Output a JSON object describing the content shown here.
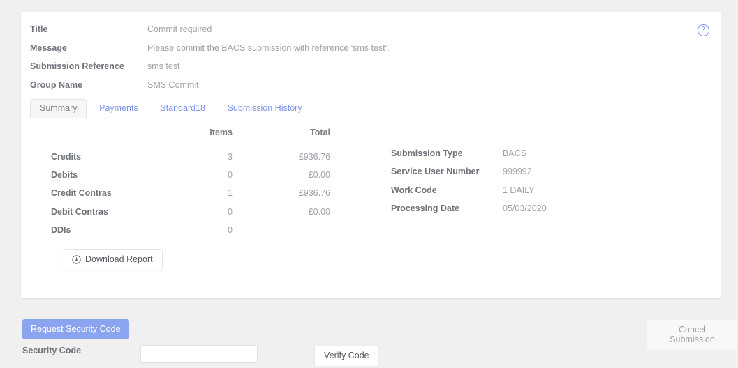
{
  "card": {
    "help_icon": "?",
    "fields": [
      {
        "label": "Title",
        "value": "Commit required"
      },
      {
        "label": "Message",
        "value": "Please commit the BACS submission with reference 'sms test'."
      },
      {
        "label": "Submission Reference",
        "value": "sms test"
      },
      {
        "label": "Group Name",
        "value": "SMS Commit"
      }
    ],
    "tabs": [
      {
        "label": "Summary",
        "active": true
      },
      {
        "label": "Payments",
        "active": false
      },
      {
        "label": "Standard18",
        "active": false
      },
      {
        "label": "Submission History",
        "active": false
      }
    ],
    "summary_table": {
      "headers": {
        "label": "",
        "items": "Items",
        "total": "Total"
      },
      "rows": [
        {
          "label": "Credits",
          "items": "3",
          "total": "£936.76"
        },
        {
          "label": "Debits",
          "items": "0",
          "total": "£0.00"
        },
        {
          "label": "Credit Contras",
          "items": "1",
          "total": "£936.76"
        },
        {
          "label": "Debit Contras",
          "items": "0",
          "total": "£0.00"
        },
        {
          "label": "DDIs",
          "items": "0",
          "total": ""
        }
      ]
    },
    "details": [
      {
        "label": "Submission Type",
        "value": "BACS"
      },
      {
        "label": "Service User Number",
        "value": "999992"
      },
      {
        "label": "Work Code",
        "value": "1 DAILY"
      },
      {
        "label": "Processing Date",
        "value": "05/03/2020"
      }
    ],
    "download_button": {
      "label": "Download Report",
      "icon": "download-circle-icon"
    }
  },
  "actions": {
    "request_security_code_label": "Request Security Code",
    "security_code_label": "Security Code",
    "security_code_value": "",
    "security_code_placeholder": "",
    "verify_code_label": "Verify Code",
    "cancel_submission_label": "Cancel Submission"
  },
  "colors": {
    "page_background": "#f0f0f1",
    "card_background": "#ffffff",
    "accent_link": "#7b93e8",
    "primary_button": "#8ba4f0",
    "label_text": "#6f737a",
    "value_text": "#9ea2a8"
  }
}
